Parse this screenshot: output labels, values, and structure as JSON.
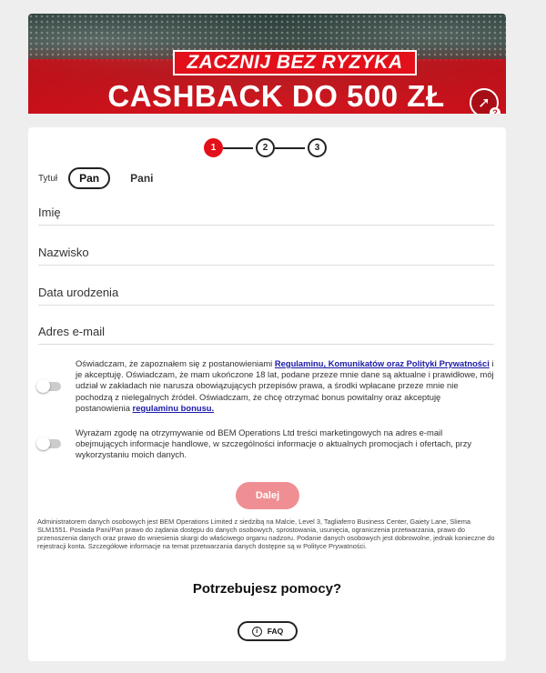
{
  "banner": {
    "tagline": "ZACZNIJ BEZ RYZYKA",
    "headline": "CASHBACK DO 500 ZŁ",
    "arrow_icon": "➚",
    "help_mark": "?"
  },
  "stepper": {
    "steps": [
      "1",
      "2",
      "3"
    ],
    "active_step": "1"
  },
  "title_select": {
    "label": "Tytuł",
    "options": [
      "Pan",
      "Pani"
    ],
    "selected": "Pan"
  },
  "form": {
    "first_name": {
      "placeholder": "Imię",
      "value": ""
    },
    "last_name": {
      "placeholder": "Nazwisko",
      "value": ""
    },
    "birth_date": {
      "placeholder": "Data urodzenia",
      "value": ""
    },
    "email": {
      "placeholder": "Adres e-mail",
      "value": ""
    }
  },
  "consent_terms": {
    "text_1": "Oświadczam, że zapoznałem się z postanowieniami ",
    "link_1": "Regulaminu, Komunikatów oraz Polityki Prywatności",
    "text_2": " i je akceptuję. Oświadczam, że mam ukończone 18 lat, podane przeze mnie dane są aktualne i prawidłowe, mój udział w zakładach nie narusza obowiązujących przepisów prawa, a środki wpłacane przeze mnie nie pochodzą z nielegalnych źródeł. Oświadczam, że chcę otrzymać bonus powitalny oraz akceptuję postanowienia ",
    "link_2": "regulaminu bonusu.",
    "checked": false
  },
  "consent_marketing": {
    "text": "Wyrażam zgodę na otrzymywanie od BEM Operations Ltd treści marketingowych na adres e-mail obejmujących informacje handlowe, w szczególności informacje o aktualnych promocjach i ofertach, przy wykorzystaniu moich danych.",
    "checked": false
  },
  "next_button": "Dalej",
  "legal_notice": "Administratorem danych osobowych jest BEM Operations Limited z siedzibą na Malcie, Level 3, Tagliaferro Business Center, Gaiety Lane, Sliema SLM1551. Posiada Pani/Pan prawo do żądania dostępu do danych osobowych, sprostowania, usunięcia, ograniczenia przetwarzania, prawo do przenoszenia danych oraz prawo do wniesienia skargi do właściwego organu nadzoru. Podanie danych osobowych jest dobrowolne, jednak konieczne do rejestracji konta. Szczegółowe informacje na temat przetwarzania danych dostępne są w Polityce Prywatności.",
  "help": {
    "title": "Potrzebujesz pomocy?",
    "faq_label": "FAQ",
    "faq_icon": "i"
  },
  "colors": {
    "accent": "#e3101a",
    "button_disabled": "#ef8f93",
    "link": "#1a1aa8"
  }
}
